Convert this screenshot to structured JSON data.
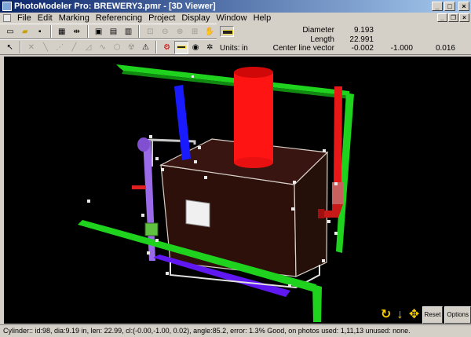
{
  "window": {
    "title": "PhotoModeler Pro: BREWERY3.pmr - [3D Viewer]"
  },
  "menu": {
    "items": [
      "File",
      "Edit",
      "Marking",
      "Referencing",
      "Project",
      "Display",
      "Window",
      "Help"
    ]
  },
  "info": {
    "diameter_label": "Diameter",
    "diameter_value": "9.193",
    "length_label": "Length",
    "length_value": "22.991",
    "units_label": "Units:",
    "units_value": "in",
    "centerline_label": "Center line vector",
    "centerline_x": "-0.002",
    "centerline_y": "-1.000",
    "centerline_z": "0.016"
  },
  "viewer_controls": {
    "reset_label": "Reset",
    "options_label": "Options"
  },
  "status": {
    "text": "Cylinder:: id:98, dia:9.19 in, len: 22.99, cl:(-0.00,-1.00, 0.02), angle:85.2, error: 1.3% Good, on photos used: 1,11,13     unused: none."
  },
  "colors": {
    "title_gradient_start": "#0a246a",
    "title_gradient_end": "#a6caf0",
    "chrome": "#d4d0c8",
    "viewer_bg": "#000000"
  }
}
